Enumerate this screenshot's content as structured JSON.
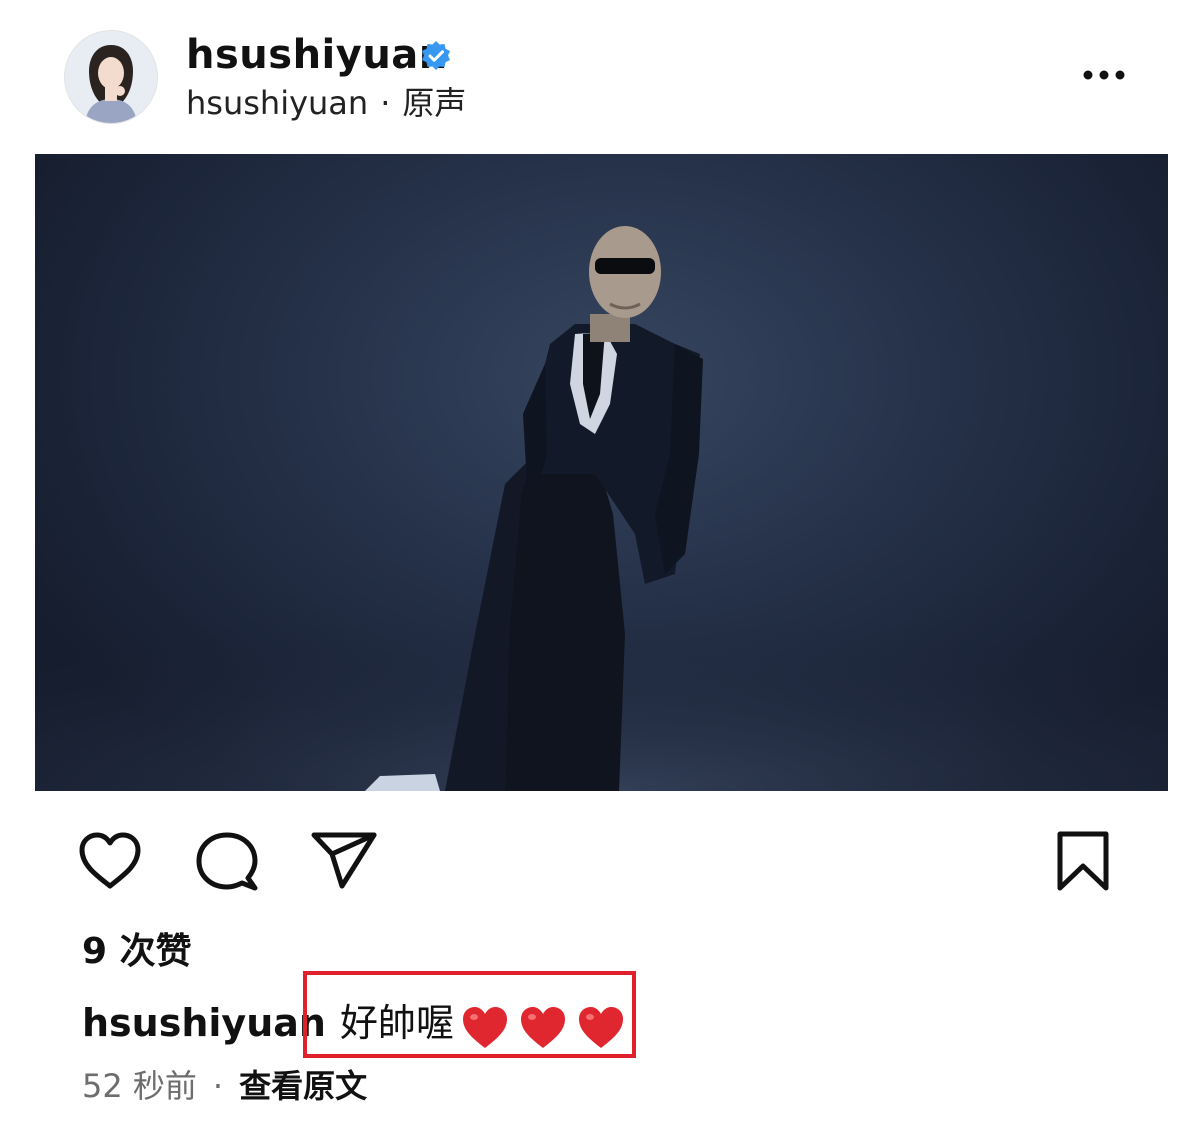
{
  "post": {
    "username": "hsushiyuan",
    "sub_user": "hsushiyuan",
    "separator": "·",
    "audio_label": "原声",
    "likes_label": "9 次赞",
    "caption_user": "hsushiyuan",
    "caption_text": "好帥喔",
    "caption_emoji": [
      "heart-emoji",
      "heart-emoji",
      "heart-emoji"
    ],
    "time_label": "52 秒前",
    "view_original_label": "查看原文"
  },
  "icons": {
    "verified": "verified-badge-icon",
    "more": "more-options-icon",
    "like": "heart-outline-icon",
    "comment": "comment-bubble-icon",
    "share": "paper-plane-icon",
    "save": "bookmark-icon"
  },
  "colors": {
    "verified_blue": "#3897f0",
    "highlight_red": "#e0202a",
    "heart_red": "#e0262e",
    "muted_text": "#6d6d6d",
    "photo_bg": "#1f2940"
  }
}
